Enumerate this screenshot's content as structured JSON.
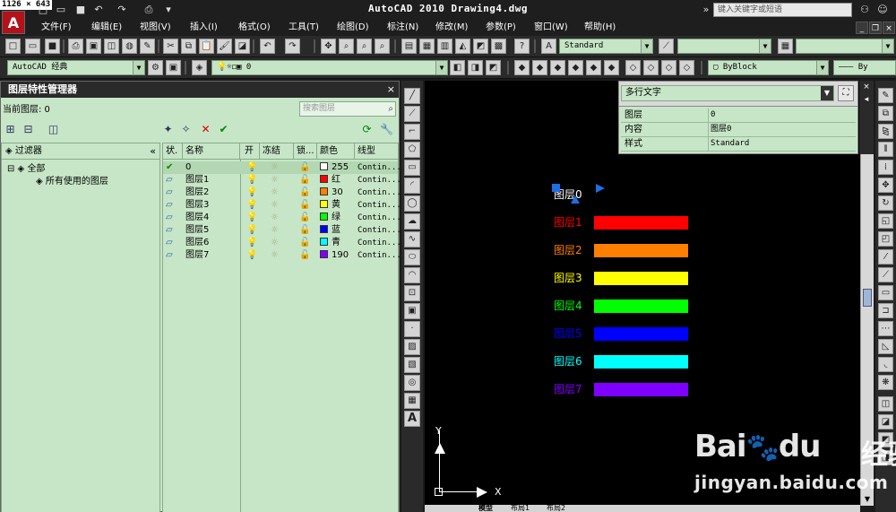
{
  "screenshot_dims": "1126 × 643",
  "window": {
    "title": "AutoCAD 2010  Drawing4.dwg",
    "search_placeholder": "键入关键字或短语"
  },
  "menu": [
    "文件(F)",
    "编辑(E)",
    "视图(V)",
    "插入(I)",
    "格式(O)",
    "工具(T)",
    "绘图(D)",
    "标注(N)",
    "修改(M)",
    "参数(P)",
    "窗口(W)",
    "帮助(H)"
  ],
  "toolbar1": {
    "text_style": "Standard"
  },
  "toolbar2": {
    "workspace": "AutoCAD 经典",
    "layer_combo": "0",
    "color_combo": "ByBlock",
    "linetype_suffix": "By"
  },
  "layer_manager": {
    "title": "图层特性管理器",
    "current_layer": "当前图层: 0",
    "search_placeholder": "搜索图层",
    "filters_header": "过滤器",
    "tree": {
      "root": "全部",
      "child": "所有使用的图层"
    },
    "columns": [
      "状.",
      "名称",
      "开",
      "冻结",
      "锁...",
      "颜色",
      "线型"
    ],
    "layers": [
      {
        "name": "0",
        "color_name": "255",
        "swatch": "#ffffff",
        "linetype": "Contin..."
      },
      {
        "name": "图层1",
        "color_name": "红",
        "swatch": "#ff0000",
        "linetype": "Contin..."
      },
      {
        "name": "图层2",
        "color_name": "30",
        "swatch": "#ff7f00",
        "linetype": "Contin..."
      },
      {
        "name": "图层3",
        "color_name": "黄",
        "swatch": "#ffff00",
        "linetype": "Contin..."
      },
      {
        "name": "图层4",
        "color_name": "绿",
        "swatch": "#00ff00",
        "linetype": "Contin..."
      },
      {
        "name": "图层5",
        "color_name": "蓝",
        "swatch": "#0000ff",
        "linetype": "Contin..."
      },
      {
        "name": "图层6",
        "color_name": "青",
        "swatch": "#00ffff",
        "linetype": "Contin..."
      },
      {
        "name": "图层7",
        "color_name": "190",
        "swatch": "#7f00ff",
        "linetype": "Contin..."
      }
    ]
  },
  "properties": {
    "object_type": "多行文字",
    "rows": [
      {
        "key": "图层",
        "value": "0"
      },
      {
        "key": "内容",
        "value": "图层0"
      },
      {
        "key": "样式",
        "value": "Standard"
      }
    ]
  },
  "drawing": {
    "items": [
      {
        "label": "图层0",
        "color": "#ffffff",
        "has_bar": false
      },
      {
        "label": "图层1",
        "color": "#ff0000",
        "has_bar": true
      },
      {
        "label": "图层2",
        "color": "#ff7f00",
        "has_bar": true
      },
      {
        "label": "图层3",
        "color": "#ffff00",
        "has_bar": true
      },
      {
        "label": "图层4",
        "color": "#00ff00",
        "has_bar": true
      },
      {
        "label": "图层5",
        "color": "#0000ff",
        "has_bar": true
      },
      {
        "label": "图层6",
        "color": "#00ffff",
        "has_bar": true
      },
      {
        "label": "图层7",
        "color": "#7f00ff",
        "has_bar": true
      }
    ],
    "ucs_x": "X",
    "ucs_y": "Y"
  },
  "layout_tabs": [
    "模型",
    "布局1",
    "布局2"
  ],
  "watermark": {
    "logo": "Bai",
    "logo_end": "du",
    "cn": "经验",
    "url": "jingyan.baidu.com"
  }
}
